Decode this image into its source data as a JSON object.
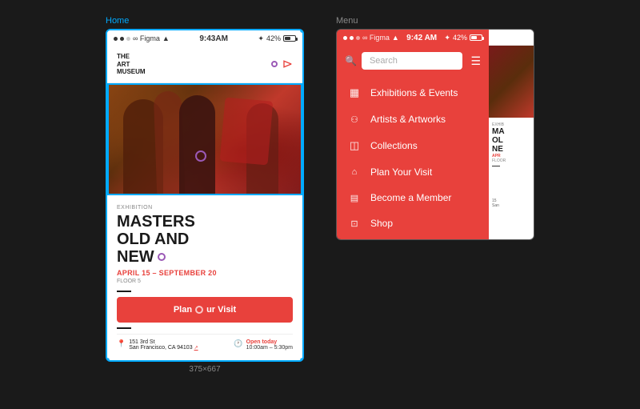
{
  "home_frame": {
    "label": "Home",
    "dimensions": "375×667",
    "status_bar": {
      "dots": 3,
      "app": "Figma",
      "wifi": "🛜",
      "time": "9:43AM",
      "bluetooth": "42%"
    },
    "navbar": {
      "museum_line1": "THE",
      "museum_line2": "ART",
      "museum_line3": "MUSEUM"
    },
    "exhibition": {
      "label": "EXHIBITION",
      "title_line1": "MASTERS",
      "title_line2": "OLD AND",
      "title_line3": "NEW",
      "dates": "APRIL 15 – SEPTEMBER 20",
      "floor": "FLOOR 5"
    },
    "cta_button": {
      "label": "Plan Your Visit"
    },
    "footer": {
      "address_line1": "151 3rd St",
      "address_line2": "San Francisco, CA 94103",
      "address_link": "↗",
      "hours_status": "Open today",
      "hours_time": "10:00am – 5:30pm"
    }
  },
  "menu_frame": {
    "label": "Menu",
    "status_bar": {
      "dots": 3,
      "app": "Figma",
      "wifi": "🛜",
      "time": "9:42 AM",
      "bluetooth": "42%"
    },
    "search": {
      "placeholder": "Search"
    },
    "menu_items": [
      {
        "id": "exhibitions",
        "icon": "▦",
        "label": "Exhibitions & Events"
      },
      {
        "id": "artists",
        "icon": "⚇",
        "label": "Artists & Artworks"
      },
      {
        "id": "collections",
        "icon": "🎁",
        "label": "Collections"
      },
      {
        "id": "plan-visit",
        "icon": "🏛",
        "label": "Plan Your Visit"
      },
      {
        "id": "become-member",
        "icon": "🪪",
        "label": "Become a Member"
      },
      {
        "id": "shop",
        "icon": "🎁",
        "label": "Shop"
      }
    ],
    "sliver": {
      "label": "EXHIB",
      "title": "MA OL NE",
      "date": "APR",
      "floor": "FLOOR"
    }
  },
  "colors": {
    "accent": "#e8413c",
    "blue": "#00aaff",
    "purple": "#9b59b6",
    "dark": "#1a1a1a",
    "light_gray": "#888"
  }
}
